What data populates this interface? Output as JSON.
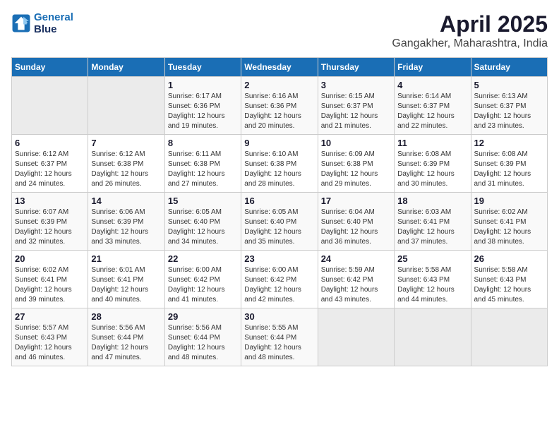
{
  "header": {
    "logo_line1": "General",
    "logo_line2": "Blue",
    "title": "April 2025",
    "subtitle": "Gangakher, Maharashtra, India"
  },
  "days_of_week": [
    "Sunday",
    "Monday",
    "Tuesday",
    "Wednesday",
    "Thursday",
    "Friday",
    "Saturday"
  ],
  "weeks": [
    [
      {
        "day": "",
        "sunrise": "",
        "sunset": "",
        "daylight": ""
      },
      {
        "day": "",
        "sunrise": "",
        "sunset": "",
        "daylight": ""
      },
      {
        "day": "1",
        "sunrise": "Sunrise: 6:17 AM",
        "sunset": "Sunset: 6:36 PM",
        "daylight": "Daylight: 12 hours and 19 minutes."
      },
      {
        "day": "2",
        "sunrise": "Sunrise: 6:16 AM",
        "sunset": "Sunset: 6:36 PM",
        "daylight": "Daylight: 12 hours and 20 minutes."
      },
      {
        "day": "3",
        "sunrise": "Sunrise: 6:15 AM",
        "sunset": "Sunset: 6:37 PM",
        "daylight": "Daylight: 12 hours and 21 minutes."
      },
      {
        "day": "4",
        "sunrise": "Sunrise: 6:14 AM",
        "sunset": "Sunset: 6:37 PM",
        "daylight": "Daylight: 12 hours and 22 minutes."
      },
      {
        "day": "5",
        "sunrise": "Sunrise: 6:13 AM",
        "sunset": "Sunset: 6:37 PM",
        "daylight": "Daylight: 12 hours and 23 minutes."
      }
    ],
    [
      {
        "day": "6",
        "sunrise": "Sunrise: 6:12 AM",
        "sunset": "Sunset: 6:37 PM",
        "daylight": "Daylight: 12 hours and 24 minutes."
      },
      {
        "day": "7",
        "sunrise": "Sunrise: 6:12 AM",
        "sunset": "Sunset: 6:38 PM",
        "daylight": "Daylight: 12 hours and 26 minutes."
      },
      {
        "day": "8",
        "sunrise": "Sunrise: 6:11 AM",
        "sunset": "Sunset: 6:38 PM",
        "daylight": "Daylight: 12 hours and 27 minutes."
      },
      {
        "day": "9",
        "sunrise": "Sunrise: 6:10 AM",
        "sunset": "Sunset: 6:38 PM",
        "daylight": "Daylight: 12 hours and 28 minutes."
      },
      {
        "day": "10",
        "sunrise": "Sunrise: 6:09 AM",
        "sunset": "Sunset: 6:38 PM",
        "daylight": "Daylight: 12 hours and 29 minutes."
      },
      {
        "day": "11",
        "sunrise": "Sunrise: 6:08 AM",
        "sunset": "Sunset: 6:39 PM",
        "daylight": "Daylight: 12 hours and 30 minutes."
      },
      {
        "day": "12",
        "sunrise": "Sunrise: 6:08 AM",
        "sunset": "Sunset: 6:39 PM",
        "daylight": "Daylight: 12 hours and 31 minutes."
      }
    ],
    [
      {
        "day": "13",
        "sunrise": "Sunrise: 6:07 AM",
        "sunset": "Sunset: 6:39 PM",
        "daylight": "Daylight: 12 hours and 32 minutes."
      },
      {
        "day": "14",
        "sunrise": "Sunrise: 6:06 AM",
        "sunset": "Sunset: 6:39 PM",
        "daylight": "Daylight: 12 hours and 33 minutes."
      },
      {
        "day": "15",
        "sunrise": "Sunrise: 6:05 AM",
        "sunset": "Sunset: 6:40 PM",
        "daylight": "Daylight: 12 hours and 34 minutes."
      },
      {
        "day": "16",
        "sunrise": "Sunrise: 6:05 AM",
        "sunset": "Sunset: 6:40 PM",
        "daylight": "Daylight: 12 hours and 35 minutes."
      },
      {
        "day": "17",
        "sunrise": "Sunrise: 6:04 AM",
        "sunset": "Sunset: 6:40 PM",
        "daylight": "Daylight: 12 hours and 36 minutes."
      },
      {
        "day": "18",
        "sunrise": "Sunrise: 6:03 AM",
        "sunset": "Sunset: 6:41 PM",
        "daylight": "Daylight: 12 hours and 37 minutes."
      },
      {
        "day": "19",
        "sunrise": "Sunrise: 6:02 AM",
        "sunset": "Sunset: 6:41 PM",
        "daylight": "Daylight: 12 hours and 38 minutes."
      }
    ],
    [
      {
        "day": "20",
        "sunrise": "Sunrise: 6:02 AM",
        "sunset": "Sunset: 6:41 PM",
        "daylight": "Daylight: 12 hours and 39 minutes."
      },
      {
        "day": "21",
        "sunrise": "Sunrise: 6:01 AM",
        "sunset": "Sunset: 6:41 PM",
        "daylight": "Daylight: 12 hours and 40 minutes."
      },
      {
        "day": "22",
        "sunrise": "Sunrise: 6:00 AM",
        "sunset": "Sunset: 6:42 PM",
        "daylight": "Daylight: 12 hours and 41 minutes."
      },
      {
        "day": "23",
        "sunrise": "Sunrise: 6:00 AM",
        "sunset": "Sunset: 6:42 PM",
        "daylight": "Daylight: 12 hours and 42 minutes."
      },
      {
        "day": "24",
        "sunrise": "Sunrise: 5:59 AM",
        "sunset": "Sunset: 6:42 PM",
        "daylight": "Daylight: 12 hours and 43 minutes."
      },
      {
        "day": "25",
        "sunrise": "Sunrise: 5:58 AM",
        "sunset": "Sunset: 6:43 PM",
        "daylight": "Daylight: 12 hours and 44 minutes."
      },
      {
        "day": "26",
        "sunrise": "Sunrise: 5:58 AM",
        "sunset": "Sunset: 6:43 PM",
        "daylight": "Daylight: 12 hours and 45 minutes."
      }
    ],
    [
      {
        "day": "27",
        "sunrise": "Sunrise: 5:57 AM",
        "sunset": "Sunset: 6:43 PM",
        "daylight": "Daylight: 12 hours and 46 minutes."
      },
      {
        "day": "28",
        "sunrise": "Sunrise: 5:56 AM",
        "sunset": "Sunset: 6:44 PM",
        "daylight": "Daylight: 12 hours and 47 minutes."
      },
      {
        "day": "29",
        "sunrise": "Sunrise: 5:56 AM",
        "sunset": "Sunset: 6:44 PM",
        "daylight": "Daylight: 12 hours and 48 minutes."
      },
      {
        "day": "30",
        "sunrise": "Sunrise: 5:55 AM",
        "sunset": "Sunset: 6:44 PM",
        "daylight": "Daylight: 12 hours and 48 minutes."
      },
      {
        "day": "",
        "sunrise": "",
        "sunset": "",
        "daylight": ""
      },
      {
        "day": "",
        "sunrise": "",
        "sunset": "",
        "daylight": ""
      },
      {
        "day": "",
        "sunrise": "",
        "sunset": "",
        "daylight": ""
      }
    ]
  ]
}
